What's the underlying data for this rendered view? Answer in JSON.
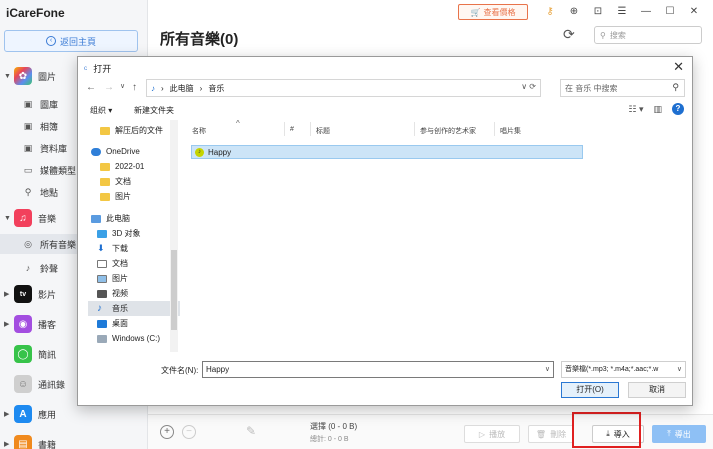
{
  "app": {
    "name": "iCareFone",
    "home_button": "返回主頁",
    "purchase_label": "查看價格",
    "search_placeholder": "搜索",
    "main_title": "所有音樂(0)",
    "accent_color": "#3a7bd5"
  },
  "sidebar": {
    "photos": "圖片",
    "photos_sub": [
      "圖庫",
      "相簿",
      "資料庫",
      "媒體類型",
      "地點"
    ],
    "music": "音樂",
    "music_sub": [
      "所有音樂",
      "鈴聲"
    ],
    "tv": "影片",
    "podcasts": "播客",
    "messages": "簡訊",
    "contacts": "通訊錄",
    "apps": "應用",
    "books": "書籍"
  },
  "bottom": {
    "selected": "選擇 (0 - 0 B)",
    "total": "總計: 0 - 0 B",
    "play": "播放",
    "delete": "刪除",
    "import": "導入",
    "export": "導出"
  },
  "dialog": {
    "title": "打开",
    "path": [
      "此电脑",
      "音乐"
    ],
    "search_placeholder": "在 音乐 中搜索",
    "organize": "组织 ▾",
    "new_folder": "新建文件夹",
    "tree": [
      "解压后的文件",
      "OneDrive",
      "2022-01",
      "文档",
      "图片",
      "此电脑",
      "3D 对象",
      "下载",
      "文档",
      "图片",
      "视频",
      "音乐",
      "桌面",
      "Windows (C:)"
    ],
    "columns": [
      "名称",
      "#",
      "标题",
      "参与创作的艺术家",
      "唱片集"
    ],
    "files": [
      {
        "name": "Happy"
      }
    ],
    "filename_label": "文件名(N):",
    "filename_value": "Happy",
    "filter": "音樂檔(*.mp3; *.m4a;*.aac;*.w",
    "open": "打开(O)",
    "cancel": "取消"
  }
}
